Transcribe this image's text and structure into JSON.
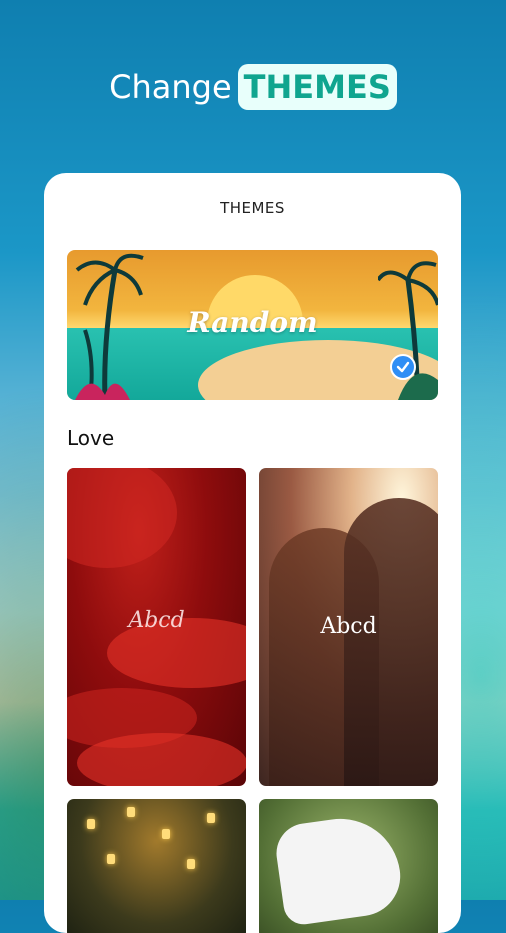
{
  "header": {
    "headline_plain": "Change",
    "headline_highlight": "THEMES"
  },
  "card": {
    "title": "THEMES",
    "featured": {
      "label": "Random",
      "selected": true
    },
    "section": {
      "label": "Love",
      "tiles": [
        {
          "label": "Abcd"
        },
        {
          "label": "Abcd"
        },
        {
          "label": ""
        },
        {
          "label": ""
        }
      ]
    }
  },
  "colors": {
    "accent": "#10a58f",
    "check": "#2f8ef5"
  }
}
